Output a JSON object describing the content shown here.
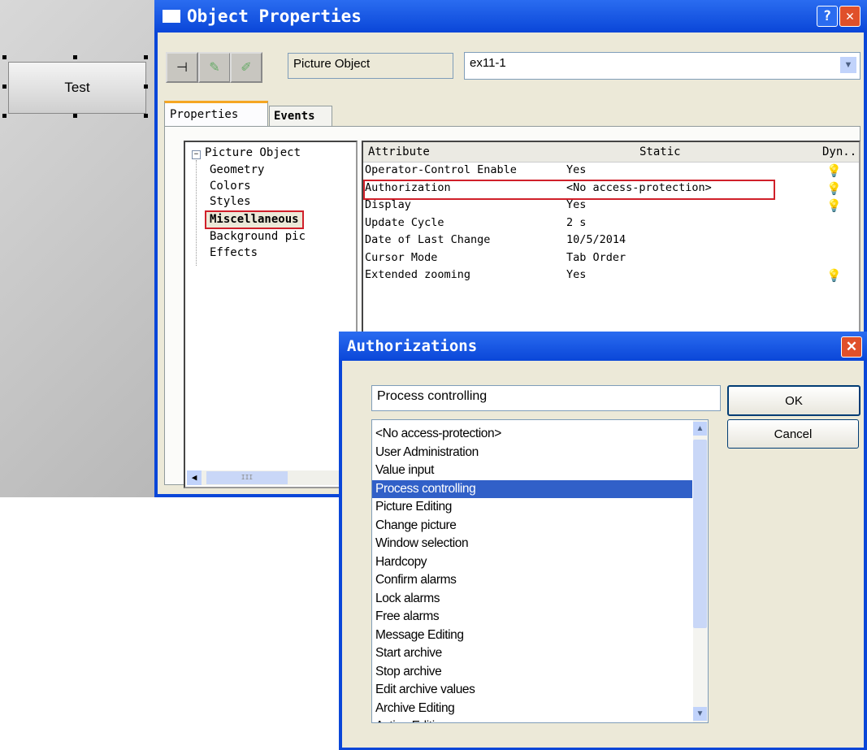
{
  "canvas": {
    "test_button": "Test"
  },
  "object_properties": {
    "title": "Object Properties",
    "help": "?",
    "close": "✕",
    "object_type": "Picture Object",
    "object_name": "ex11-1",
    "tabs": [
      {
        "label": "Properties"
      },
      {
        "label": "Events"
      }
    ],
    "tree": {
      "root": "Picture Object",
      "expander": "−",
      "children": [
        "Geometry",
        "Colors",
        "Styles",
        "Miscellaneous",
        "Background pic",
        "Effects"
      ]
    },
    "table": {
      "headers": [
        "Attribute",
        "Static",
        "Dyn.."
      ],
      "rows": [
        {
          "attribute": "Operator-Control Enable",
          "static": "Yes",
          "dynamic": true
        },
        {
          "attribute": "Authorization",
          "static": "<No access-protection>",
          "dynamic": true
        },
        {
          "attribute": "Display",
          "static": "Yes",
          "dynamic": true
        },
        {
          "attribute": "Update Cycle",
          "static": "2 s",
          "dynamic": false
        },
        {
          "attribute": "Date of Last Change",
          "static": "10/5/2014",
          "dynamic": false
        },
        {
          "attribute": "Cursor Mode",
          "static": "Tab Order",
          "dynamic": false
        },
        {
          "attribute": "Extended zooming",
          "static": "Yes",
          "dynamic": true
        }
      ]
    },
    "scroll_thumb": "III"
  },
  "authorizations": {
    "title": "Authorizations",
    "close": "✕",
    "value": "Process controlling",
    "ok": "OK",
    "cancel": "Cancel",
    "selected": "Process controlling",
    "items": [
      "<No access-protection>",
      "User Administration",
      "Value input",
      "Process controlling",
      "Picture Editing",
      "Change picture",
      "Window selection",
      "Hardcopy",
      "Confirm alarms",
      "Lock alarms",
      "Free alarms",
      "Message Editing",
      "Start archive",
      "Stop archive",
      "Edit archive values",
      "Archive Editing",
      "Action Editing"
    ]
  }
}
